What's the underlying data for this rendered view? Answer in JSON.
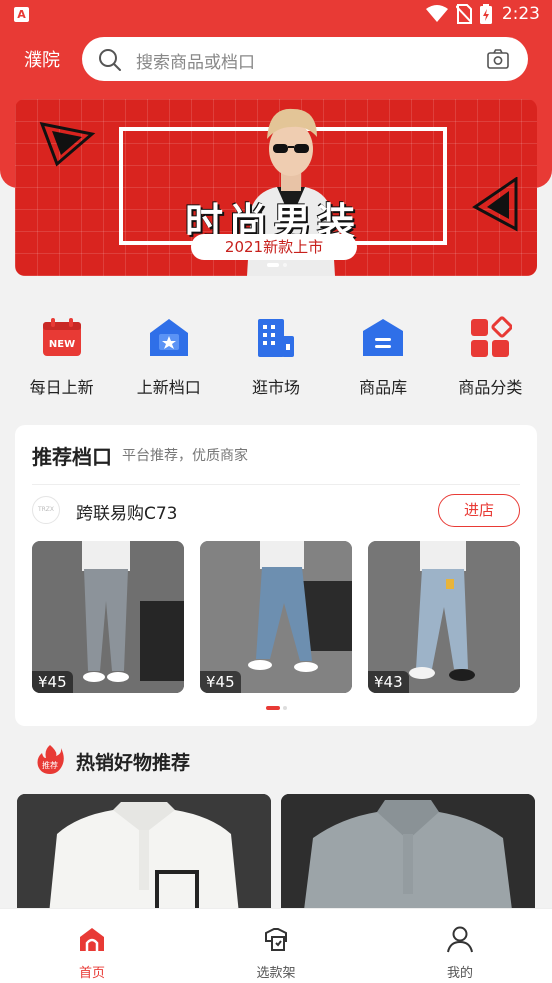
{
  "status_bar": {
    "time": "2:23",
    "app_badge": "A"
  },
  "header": {
    "location": "濮院",
    "search_placeholder": "搜索商品或档口"
  },
  "banner": {
    "title": "时尚男装",
    "subtitle": "2021新款上市"
  },
  "categories": [
    {
      "label": "每日上新",
      "icon": "calendar-new-icon",
      "badge": "NEW"
    },
    {
      "label": "上新档口",
      "icon": "store-star-icon"
    },
    {
      "label": "逛市场",
      "icon": "building-icon"
    },
    {
      "label": "商品库",
      "icon": "warehouse-icon"
    },
    {
      "label": "商品分类",
      "icon": "category-grid-icon"
    }
  ],
  "recommend": {
    "title": "推荐档口",
    "subtitle": "平台推荐，优质商家",
    "shop_name": "跨联易购C73",
    "shop_logo_text": "TRZX",
    "enter_label": "进店",
    "products": [
      {
        "price": "¥45"
      },
      {
        "price": "¥45"
      },
      {
        "price": "¥43"
      }
    ]
  },
  "hot": {
    "badge": "推荐",
    "title": "热销好物推荐"
  },
  "bottom_nav": [
    {
      "label": "首页",
      "icon": "home-icon",
      "active": true
    },
    {
      "label": "选款架",
      "icon": "shirt-hanger-icon",
      "active": false
    },
    {
      "label": "我的",
      "icon": "user-icon",
      "active": false
    }
  ],
  "colors": {
    "accent": "#e83a35",
    "background": "#f2f2f2"
  }
}
